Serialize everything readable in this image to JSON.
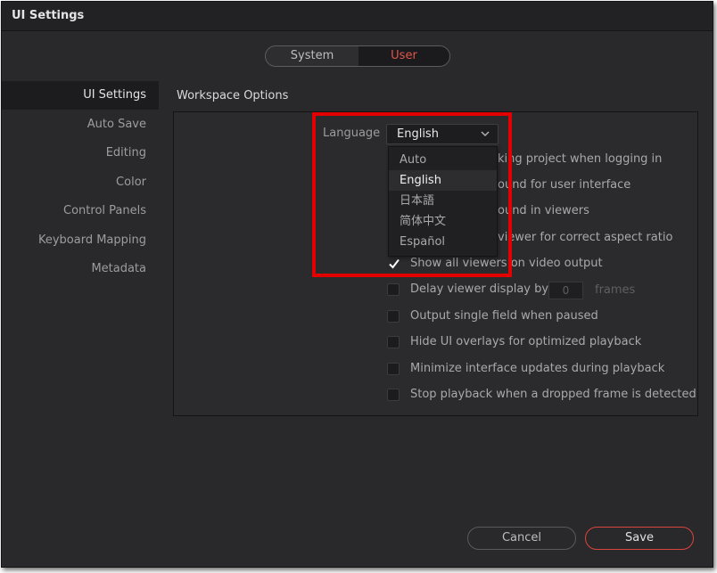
{
  "window": {
    "title": "UI Settings"
  },
  "tabs": [
    {
      "label": "System",
      "active": false
    },
    {
      "label": "User",
      "active": true
    }
  ],
  "sidebar": {
    "items": [
      {
        "label": "UI Settings",
        "active": true
      },
      {
        "label": "Auto Save"
      },
      {
        "label": "Editing"
      },
      {
        "label": "Color"
      },
      {
        "label": "Control Panels"
      },
      {
        "label": "Keyboard Mapping"
      },
      {
        "label": "Metadata"
      }
    ]
  },
  "section": {
    "title": "Workspace Options"
  },
  "language": {
    "label": "Language",
    "selected": "English",
    "options": [
      "Auto",
      "English",
      "日本語",
      "简体中文",
      "Español"
    ]
  },
  "options": [
    {
      "label": "king project when logging in",
      "checked": false
    },
    {
      "label": "ound for user interface",
      "checked": false
    },
    {
      "label": "ound in viewers",
      "checked": false
    },
    {
      "label": "viewer for correct aspect ratio",
      "checked": false
    },
    {
      "label": "Show all viewers on video output",
      "checked": true
    },
    {
      "label": "Delay viewer display by",
      "checked": false,
      "value": "0",
      "unit": "frames"
    },
    {
      "label": "Output single field when paused",
      "checked": false
    },
    {
      "label": "Hide UI overlays for optimized playback",
      "checked": false
    },
    {
      "label": "Minimize interface updates during playback",
      "checked": false
    },
    {
      "label": "Stop playback when a dropped frame is detected",
      "checked": false
    }
  ],
  "buttons": {
    "cancel": "Cancel",
    "save": "Save"
  },
  "colors": {
    "accent": "#e2544c",
    "highlight": "#e20000",
    "background": "#29292b"
  }
}
